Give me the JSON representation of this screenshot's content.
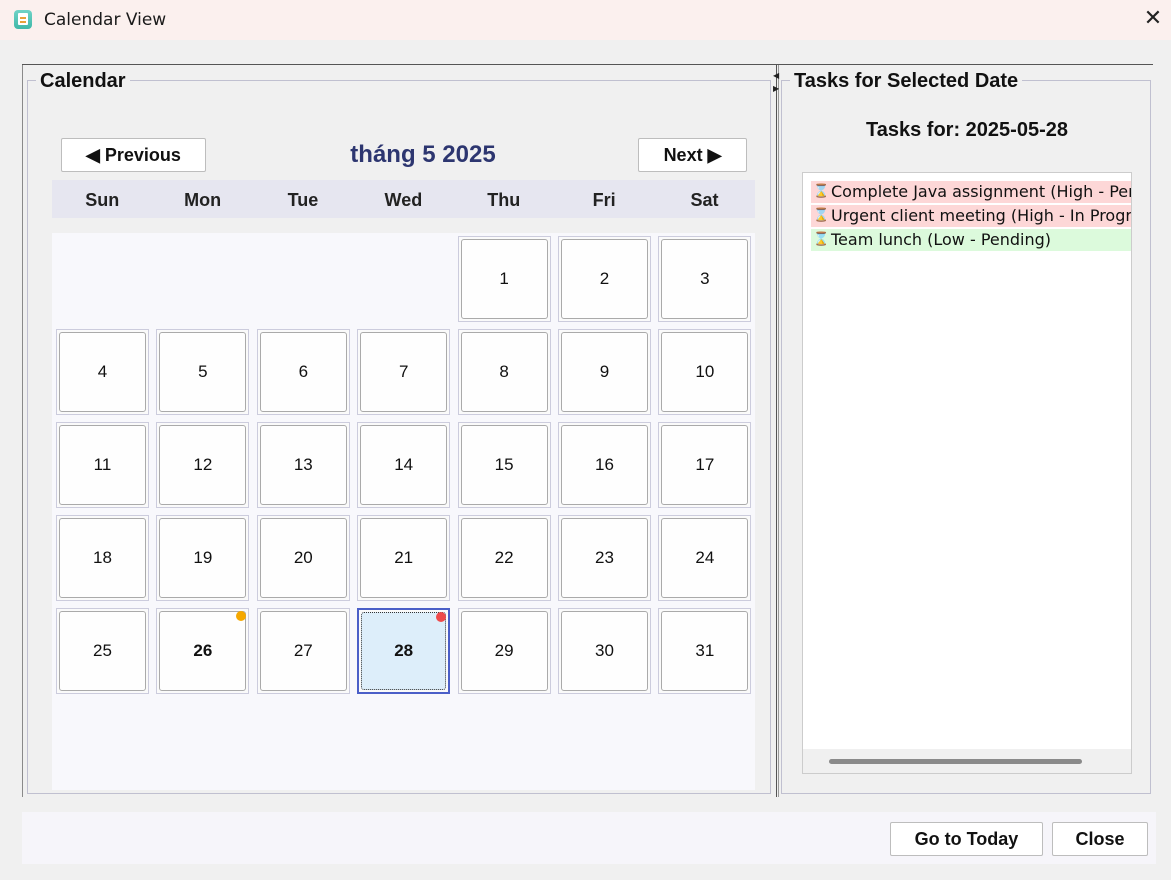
{
  "window": {
    "title": "Calendar View",
    "close_glyph": "✕",
    "icon": "calendar-app-icon"
  },
  "calendar": {
    "group_title": "Calendar",
    "prev_label": "◀ Previous",
    "next_label": "Next ▶",
    "month_label": "tháng 5 2025",
    "weekdays": [
      "Sun",
      "Mon",
      "Tue",
      "Wed",
      "Thu",
      "Fri",
      "Sat"
    ],
    "first_weekday_index": 4,
    "days_in_month": 31,
    "selected_day": 28,
    "bold_days": [
      26,
      28
    ],
    "task_dots": [
      {
        "day": 26,
        "color": "#f5a800"
      },
      {
        "day": 28,
        "color": "#ee4a4a"
      }
    ]
  },
  "tasks": {
    "group_title": "Tasks for Selected Date",
    "heading": "Tasks for: 2025-05-28",
    "items": [
      {
        "text": "Complete Java assignment (High - Pendin",
        "bg": "#fdd7d7",
        "icon": "hourglass-icon",
        "glyph": "⌛"
      },
      {
        "text": "Urgent client meeting (High - In Progress",
        "bg": "#fdd7d7",
        "icon": "hourglass-icon",
        "glyph": "⌛"
      },
      {
        "text": "Team lunch (Low - Pending)",
        "bg": "#dcfadc",
        "icon": "hourglass-icon",
        "glyph": "⌛"
      }
    ]
  },
  "footer": {
    "today_label": "Go to Today",
    "close_label": "Close"
  }
}
